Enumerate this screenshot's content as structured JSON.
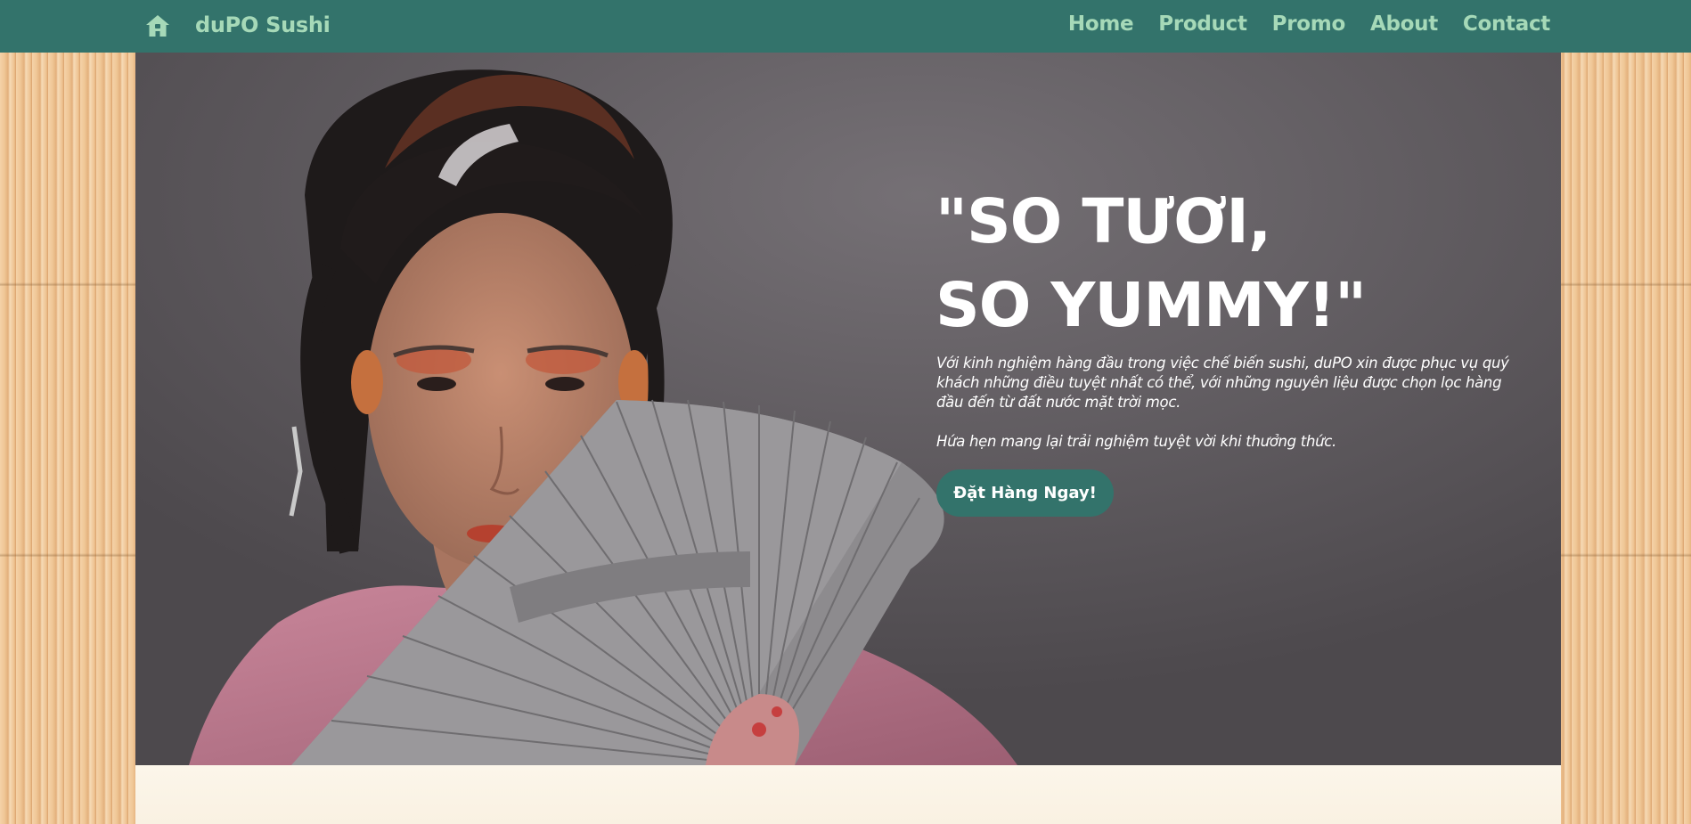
{
  "brand": {
    "name": "duPO Sushi",
    "icon": "home-icon"
  },
  "nav": {
    "links": [
      "Home",
      "Product",
      "Promo",
      "About",
      "Contact"
    ]
  },
  "hero": {
    "headline_line1": "\"SO TƯƠI,",
    "headline_line2": "SO YUMMY!\"",
    "paragraph1": "Với kinh nghiệm hàng đầu trong việc chế biến sushi, duPO xin được phục vụ quý khách những điều tuyệt nhất có thể, với những nguyên liệu được chọn lọc hàng đầu đến từ đất nước mặt trời mọc.",
    "paragraph2": "Hứa hẹn mang lại trải nghiệm tuyệt vời khi thưởng thức.",
    "cta_label": "Đặt Hàng Ngay!"
  },
  "colors": {
    "nav_bg": "#33736b",
    "nav_text": "#a6d9b8",
    "hero_bg": "#5c585c",
    "cta_bg": "#33736b",
    "panel_bg": "#fcf6ea",
    "mat": "#f0c796"
  }
}
